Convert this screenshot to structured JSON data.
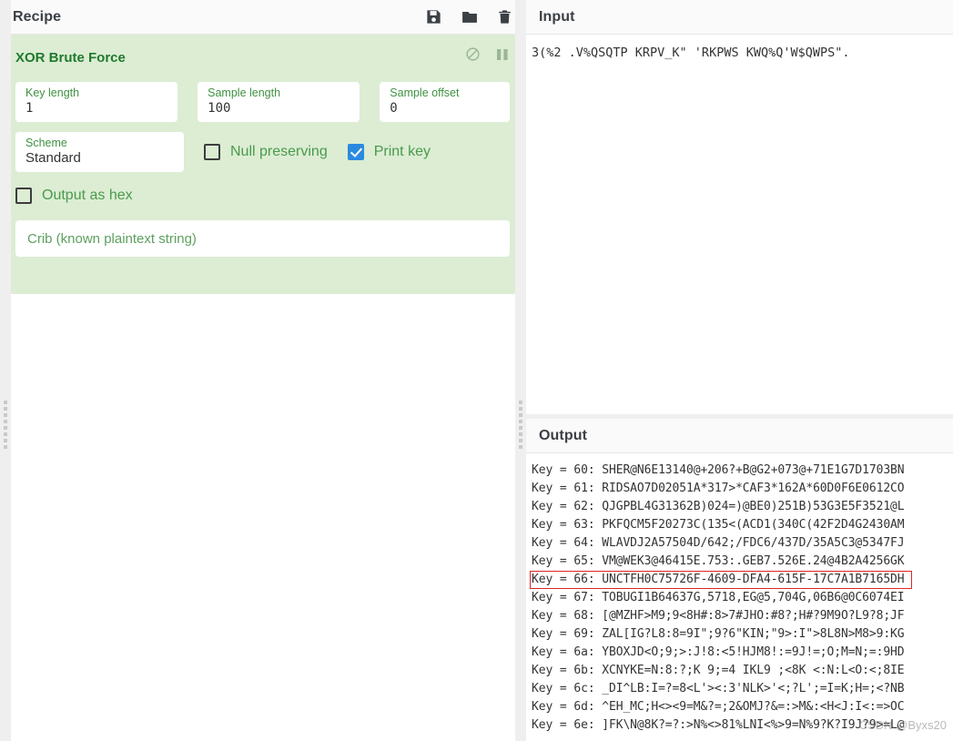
{
  "recipe": {
    "title": "Recipe",
    "icons": [
      {
        "name": "save-icon",
        "label": "Save recipe"
      },
      {
        "name": "folder-icon",
        "label": "Load recipe"
      },
      {
        "name": "trash-icon",
        "label": "Clear recipe"
      }
    ],
    "operation": {
      "title": "XOR Brute Force",
      "controls": [
        {
          "name": "disable-icon",
          "label": "Disable operation"
        },
        {
          "name": "pause-icon",
          "label": "Pause / breakpoint"
        }
      ],
      "fields": [
        {
          "label": "Key length",
          "value": "1"
        },
        {
          "label": "Sample length",
          "value": "100"
        },
        {
          "label": "Sample offset",
          "value": "0"
        },
        {
          "label": "Scheme",
          "value": "Standard"
        }
      ],
      "checkboxes": [
        {
          "label": "Null preserving",
          "checked": false
        },
        {
          "label": "Print key",
          "checked": true
        },
        {
          "label": "Output as hex",
          "checked": false
        }
      ],
      "crib_placeholder": "Crib (known plaintext string)"
    }
  },
  "input": {
    "title": "Input",
    "text": "3(%2 .V%QSQTP KRPV_K\" 'RKPWS KWQ%Q'W$QWPS\"."
  },
  "output": {
    "title": "Output",
    "highlight_index": 6,
    "lines": [
      "Key = 60: SHER@N6E13140@+206?+B@G2+073@+71E1G7D1703BN",
      "Key = 61: RIDSAO7D02051A*317>*CAF3*162A*60D0F6E0612CO",
      "Key = 62: QJGPBL4G31362B)024=)@BE0)251B)53G3E5F3521@L",
      "Key = 63: PKFQCM5F20273C(135<(ACD1(340C(42F2D4G2430AM",
      "Key = 64: WLAVDJ2A57504D/642;/FDC6/437D/35A5C3@5347FJ",
      "Key = 65: VM@WEK3@46415E.753:.GEB7.526E.24@4B2A4256GK",
      "Key = 66: UNCTFH0C75726F-4609-DFA4-615F-17C7A1B7165DH",
      "Key = 67: TOBUGI1B64637G,5718,EG@5,704G,06B6@0C6074EI",
      "Key = 68: [@MZHF>M9;9<8H#:8>7#JHO:#8?;H#?9M9O?L9?8;JF",
      "Key = 69: ZAL[IG?L8:8=9I\";9?6\"KIN;\"9>:I\">8L8N>M8>9:KG",
      "Key = 6a: YBOXJD<O;9;>:J!8:<5!HJM8!:=9J!=;O;M=N;=:9HD",
      "Key = 6b: XCNYKE=N:8:?;K 9;=4 IKL9 ;<8K <:N:L<O:<;8IE",
      "Key = 6c: _DI^LB:I=?=8<L'><:3'NLK>'<;?L';=I=K;H=;<?NB",
      "Key = 6d: ^EH_MC;H<><9=M&?=;2&OMJ?&=:>M&:<H<J:I<:=>OC",
      "Key = 6e: ]FK\\N@8K?=?:>N%<>81%LNI<%>9=N%9?K?I9J?9>=L@"
    ]
  },
  "watermark": "CSDN @Byxs20",
  "colors": {
    "operation_bg": "#dcedd3",
    "operation_title": "#1f7a2e",
    "field_label": "#3f9142",
    "checkbox_checked": "#2b8ae0",
    "highlight_border": "#e02424"
  }
}
